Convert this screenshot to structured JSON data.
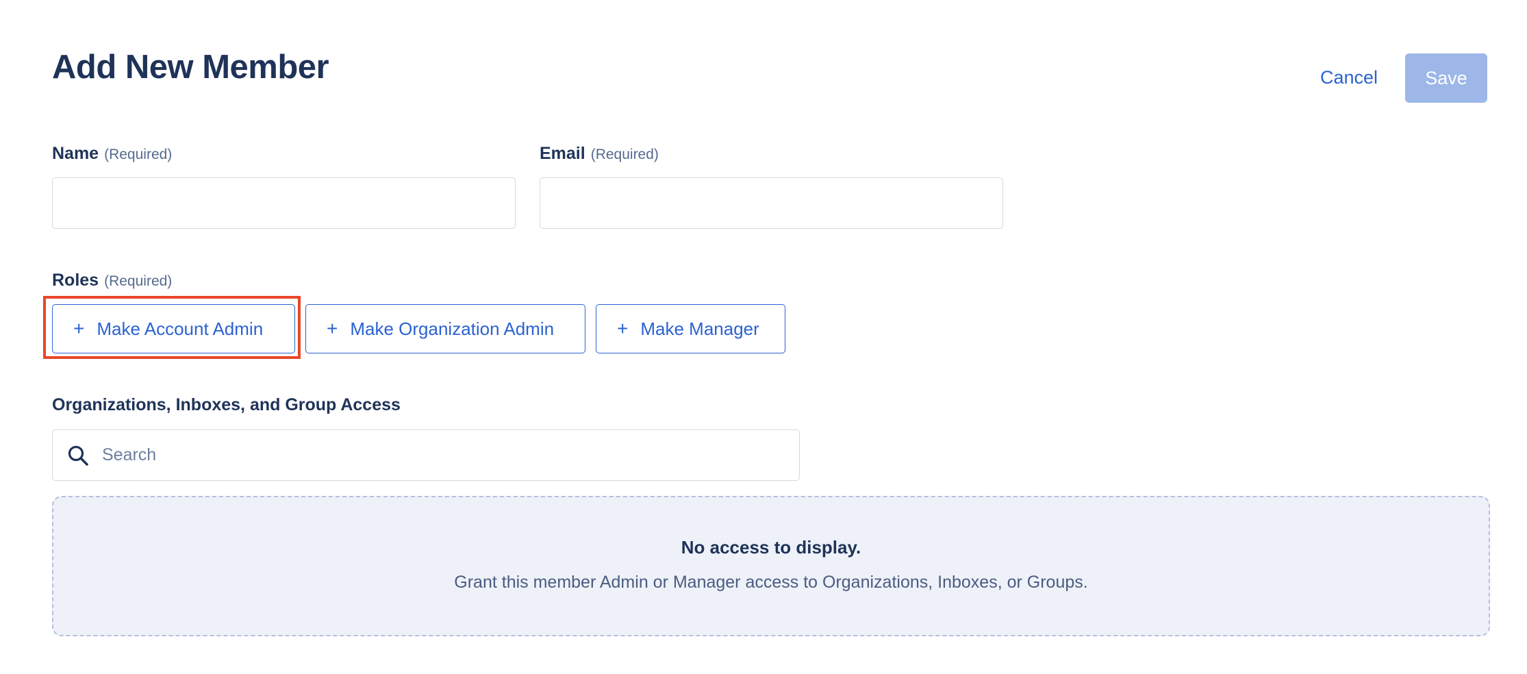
{
  "header": {
    "title": "Add New Member",
    "cancel_label": "Cancel",
    "save_label": "Save"
  },
  "form": {
    "name": {
      "label": "Name",
      "required": "(Required)",
      "value": "",
      "placeholder": ""
    },
    "email": {
      "label": "Email",
      "required": "(Required)",
      "value": "",
      "placeholder": ""
    },
    "roles": {
      "label": "Roles",
      "required": "(Required)",
      "buttons": [
        {
          "icon": "+",
          "label": "Make Account Admin",
          "highlighted": true
        },
        {
          "icon": "+",
          "label": "Make Organization Admin",
          "highlighted": false
        },
        {
          "icon": "+",
          "label": "Make Manager",
          "highlighted": false
        }
      ]
    },
    "access": {
      "label": "Organizations, Inboxes, and Group Access",
      "search_placeholder": "Search",
      "search_icon": "search-icon",
      "empty_title": "No access to display.",
      "empty_description": "Grant this member Admin or Manager access to Organizations, Inboxes, or Groups."
    }
  },
  "colors": {
    "primary": "#2b62d2",
    "save_disabled_bg": "#9cb7e8",
    "heading": "#1f3358",
    "highlight": "#e8472a",
    "empty_bg": "#eef1f8",
    "empty_border": "#b7bfdf"
  }
}
